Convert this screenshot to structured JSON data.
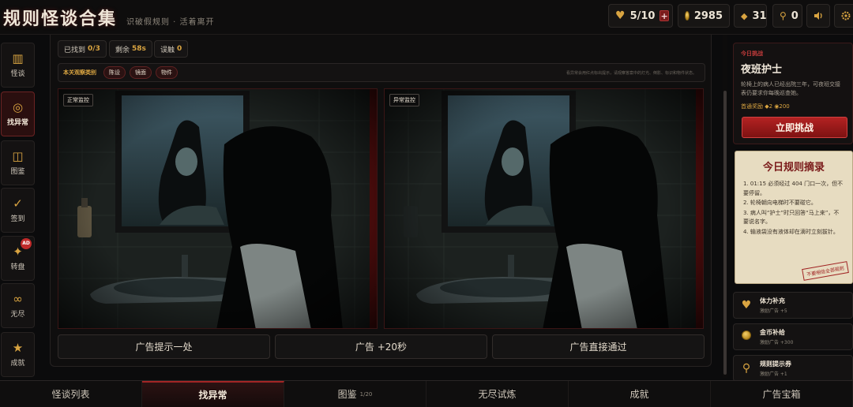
{
  "header": {
    "title": "规则怪谈合集",
    "tagline": "识破假规则 · 活着离开",
    "lives": "5/10",
    "lives_plus": "+",
    "coins": "2985",
    "gems": "31",
    "keys": "0",
    "icons": [
      "heart-icon",
      "coin-icon",
      "diamond-icon",
      "key-icon",
      "sound-icon",
      "settings-icon"
    ]
  },
  "sidebar": {
    "items": [
      {
        "label": "怪谈",
        "icon": "books-icon"
      },
      {
        "label": "找异常",
        "icon": "eye-icon"
      },
      {
        "label": "图鉴",
        "icon": "book-icon"
      },
      {
        "label": "签到",
        "icon": "check-icon"
      },
      {
        "label": "转盘",
        "icon": "sparkle-icon",
        "badge": "AD"
      },
      {
        "label": "无尽",
        "icon": "infinity-icon"
      },
      {
        "label": "成就",
        "icon": "star-icon"
      }
    ]
  },
  "main": {
    "found_label": "已找到",
    "found_value": "0/3",
    "time_label": "剩余",
    "time_value": "58s",
    "wrong_label": "误触",
    "wrong_value": "0",
    "category_title": "本关观察类别",
    "categories": [
      "陈设",
      "镜面",
      "物件"
    ],
    "category_hint": "看异常会用红点标出提示，请观察答案中的灯光、倒影、标识和物件状态。",
    "scene_left_label": "正常监控",
    "scene_right_label": "异常监控",
    "buttons": {
      "hint": "广告提示一处",
      "add_time": "广告 +20秒",
      "skip": "广告直接通过"
    }
  },
  "challenge": {
    "tag": "今日挑战",
    "title": "夜班护士",
    "desc": "轮椅上的病人已经出院三年，可夜班交接表仍要求你每晚巡查她。",
    "reward_label": "首通奖励 ◆2",
    "reward_coins": "◉200",
    "button": "立即挑战"
  },
  "rules": {
    "title": "今日规则摘录",
    "items": [
      "1. 01:15 必须经过 404 门口一次，但不要停留。",
      "2. 轮椅朝向电梯时不要碰它。",
      "3. 病人叫“护士”时只回答“马上来”，不要说名字。",
      "4. 输液袋没有液体却在滴时立刻拔针。"
    ],
    "stamp": "不要相信全部规则"
  },
  "boosters": [
    {
      "title": "体力补充",
      "sub": "激励广告 +5",
      "icon": "heart-icon"
    },
    {
      "title": "金币补给",
      "sub": "激励广告 +300",
      "icon": "coin-icon"
    },
    {
      "title": "规则提示券",
      "sub": "激励广告 +1",
      "icon": "key-icon"
    }
  ],
  "bottom_nav": [
    {
      "label": "怪谈列表"
    },
    {
      "label": "找异常"
    },
    {
      "label": "图鉴",
      "sub": "1/20"
    },
    {
      "label": "无尽试炼"
    },
    {
      "label": "成就"
    },
    {
      "label": "广告宝箱"
    }
  ],
  "colors": {
    "accent_gold": "#d9a441",
    "accent_red": "#b32222",
    "parchment": "#e7dcc1",
    "background": "#0b0b0c"
  }
}
